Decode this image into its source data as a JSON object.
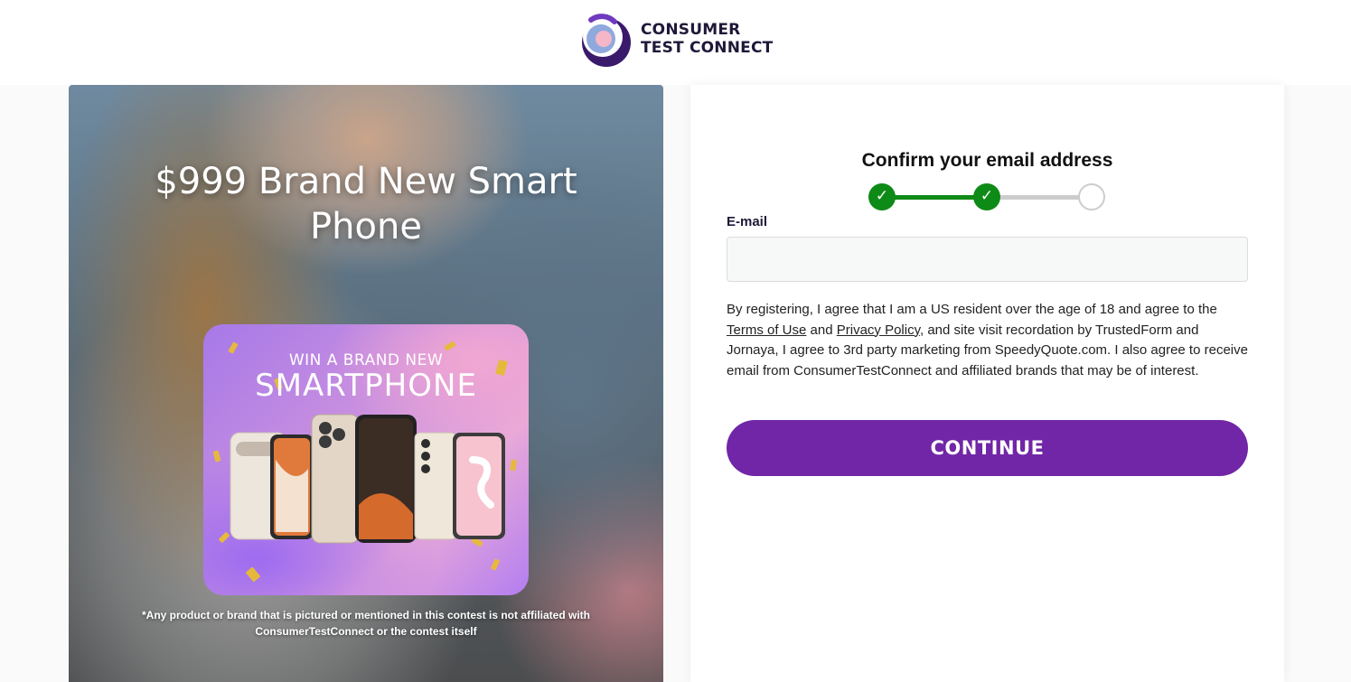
{
  "brand": {
    "line1": "CONSUMER",
    "line2": "TEST CONNECT"
  },
  "hero": {
    "title": "$999 Brand New Smart Phone",
    "promo_line1": "WIN A BRAND NEW",
    "promo_line2": "SMARTPHONE",
    "disclaimer": "*Any product or brand that is pictured or mentioned in this contest is not affiliated with ConsumerTestConnect or the contest itself"
  },
  "form": {
    "title": "Confirm your email address",
    "progress": {
      "completed_steps": 2,
      "total_steps": 3
    },
    "email_label": "E-mail",
    "email_value": "",
    "consent": {
      "part1": "By registering, I agree that I am a US resident over the age of 18 and agree to the ",
      "terms_link": "Terms of Use",
      "part2": " and ",
      "privacy_link": "Privacy Policy",
      "part3": ", and site visit recordation by TrustedForm and Jornaya, I agree to 3rd party marketing from SpeedyQuote.com. I also agree to receive email from ConsumerTestConnect and affiliated brands that may be of interest."
    },
    "continue_label": "CONTINUE",
    "check_glyph": "✓"
  },
  "colors": {
    "accent": "#7026a6",
    "step_complete": "#0e8a16",
    "step_incomplete": "#cccccc"
  }
}
